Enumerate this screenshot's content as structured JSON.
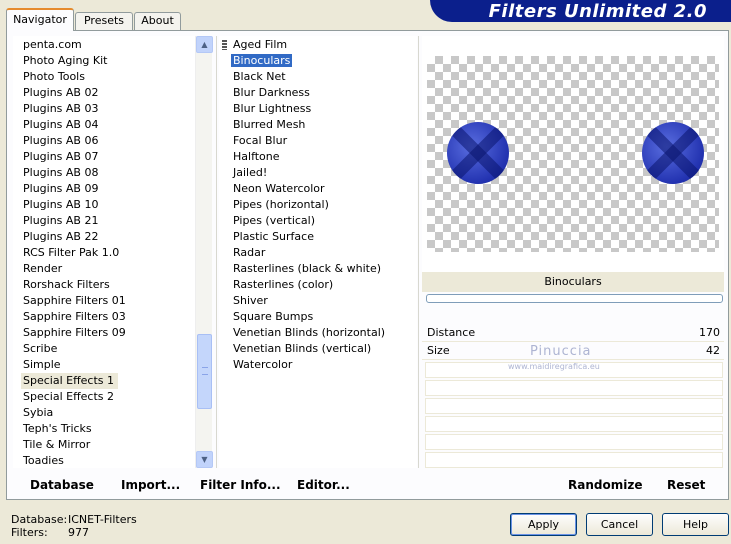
{
  "tabs": [
    "Navigator",
    "Presets",
    "About"
  ],
  "banner_title": "Filters Unlimited 2.0",
  "categories": [
    "penta.com",
    "Photo Aging Kit",
    "Photo Tools",
    "Plugins AB 02",
    "Plugins AB 03",
    "Plugins AB 04",
    "Plugins AB 06",
    "Plugins AB 07",
    "Plugins AB 08",
    "Plugins AB 09",
    "Plugins AB 10",
    "Plugins AB 21",
    "Plugins AB 22",
    "RCS Filter Pak 1.0",
    "Render",
    "Rorshack Filters",
    "Sapphire Filters 01",
    "Sapphire Filters 03",
    "Sapphire Filters 09",
    "Scribe",
    "Simple",
    "Special Effects 1",
    "Special Effects 2",
    "Sybia",
    "Teph's Tricks",
    "Tile & Mirror",
    "Toadies"
  ],
  "selected_category": "Special Effects 1",
  "filters": [
    "Aged Film",
    "Binoculars",
    "Black Net",
    "Blur Darkness",
    "Blur Lightness",
    "Blurred Mesh",
    "Focal Blur",
    "Halftone",
    "Jailed!",
    "Neon Watercolor",
    "Pipes (horizontal)",
    "Pipes (vertical)",
    "Plastic Surface",
    "Radar",
    "Rasterlines (black & white)",
    "Rasterlines (color)",
    "Shiver",
    "Square Bumps",
    "Venetian Blinds (horizontal)",
    "Venetian Blinds (vertical)",
    "Watercolor"
  ],
  "selected_filter": "Binoculars",
  "params": {
    "title": "Binoculars",
    "distance_label": "Distance",
    "distance_value": "170",
    "size_label": "Size",
    "size_value": "42"
  },
  "watermark": {
    "line1": "Pinuccia",
    "line2": "www.maidiregrafica.eu"
  },
  "bottom_bar": {
    "database": "Database",
    "import": "Import...",
    "filter_info": "Filter Info...",
    "editor": "Editor...",
    "randomize": "Randomize",
    "reset": "Reset"
  },
  "status": {
    "database_label": "Database:",
    "database_value": "ICNET-Filters",
    "filters_label": "Filters:",
    "filters_value": "977"
  },
  "dialog_buttons": {
    "apply": "Apply",
    "cancel": "Cancel",
    "help": "Help"
  }
}
